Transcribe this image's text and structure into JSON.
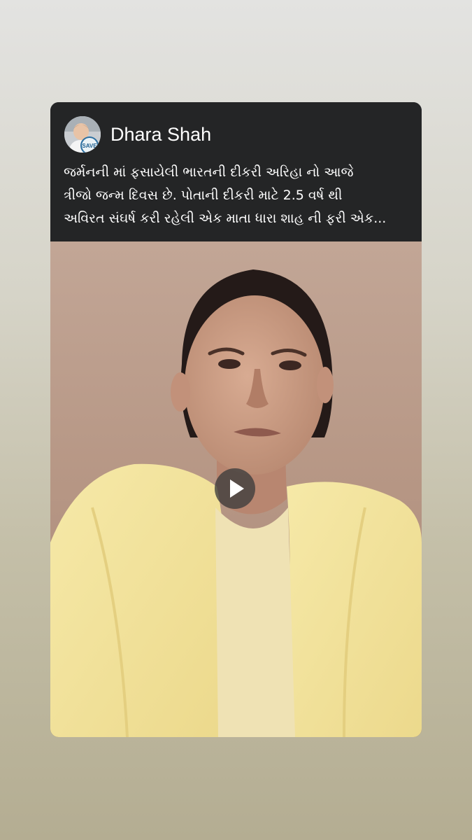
{
  "post": {
    "author": "Dhara Shah",
    "avatar_badge": "SAVE",
    "caption_lines": [
      "જર્મનની માં ફસાયેલી ભારતની દીકરી અરિહા નો આજે",
      "ત્રીજો જન્મ દિવસ છે. પોતાની દીકરી માટે 2.5 વર્ષ થી",
      "અવિરત સંઘર્ષ કરી રહેલી એક માતા ધારા શાહ ની ફરી એક..."
    ]
  },
  "video": {
    "play_icon": "play-icon"
  },
  "colors": {
    "page_top": "#e3e3e1",
    "page_bottom": "#b4ad92",
    "card_bg": "#242526",
    "text": "#ffffff"
  }
}
